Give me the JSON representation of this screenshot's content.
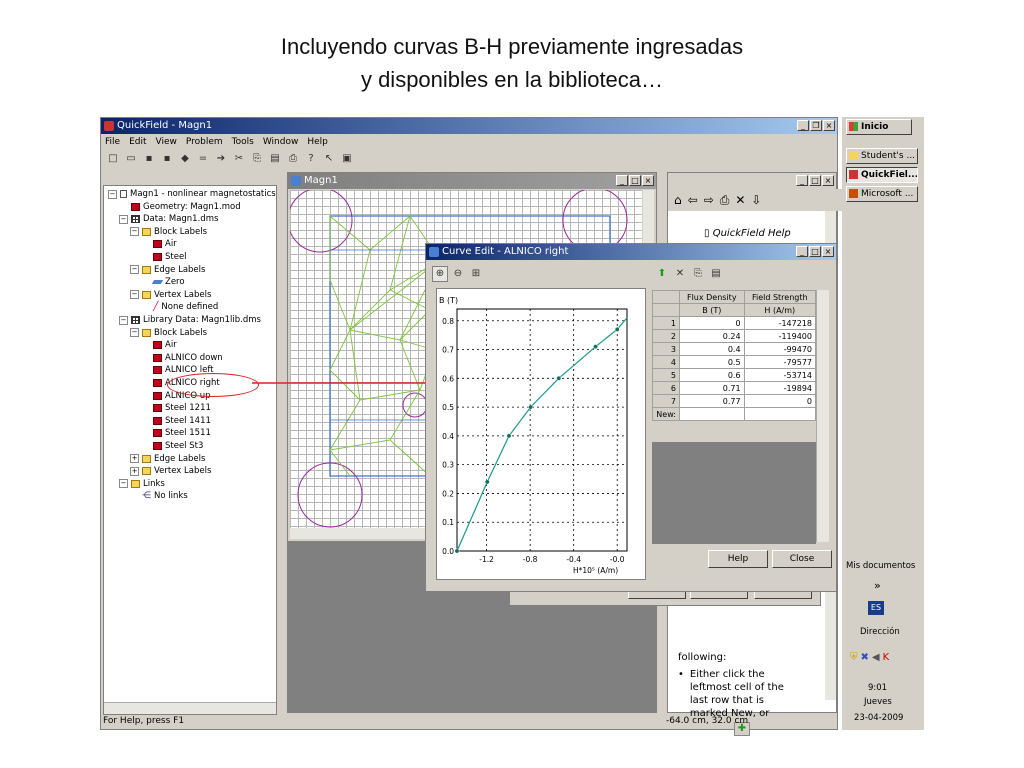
{
  "caption": {
    "line1": "Incluyendo curvas B-H previamente ingresadas",
    "line2": "y disponibles en la biblioteca…"
  },
  "main_window": {
    "title": "QuickField - Magn1",
    "menu": [
      "File",
      "Edit",
      "View",
      "Problem",
      "Tools",
      "Window",
      "Help"
    ],
    "status_left": "For Help, press F1",
    "status_right": "-64.0 cm, 32.0 cm"
  },
  "tree": {
    "items": [
      {
        "label": "Magn1 - nonlinear magnetostatics p",
        "icon": "doc-icon",
        "expander": "−"
      },
      {
        "label": "Geometry: Magn1.mod",
        "icon": "geometry-icon",
        "expander": ""
      },
      {
        "label": "Data: Magn1.dms",
        "icon": "table-icon",
        "expander": "−"
      },
      {
        "label": "Block Labels",
        "icon": "folder-icon",
        "expander": "−"
      },
      {
        "label": "Air",
        "icon": "block-icon",
        "expander": ""
      },
      {
        "label": "Steel",
        "icon": "block-icon",
        "expander": ""
      },
      {
        "label": "Edge Labels",
        "icon": "folder-icon",
        "expander": "−"
      },
      {
        "label": "Zero",
        "icon": "edge-icon",
        "expander": ""
      },
      {
        "label": "Vertex Labels",
        "icon": "folder-icon",
        "expander": "−"
      },
      {
        "label": "None defined",
        "icon": "vertex-icon",
        "expander": ""
      },
      {
        "label": "Library Data: Magn1lib.dms",
        "icon": "table-icon",
        "expander": "−"
      },
      {
        "label": "Block Labels",
        "icon": "folder-icon",
        "expander": "−"
      },
      {
        "label": "Air",
        "icon": "block-icon",
        "expander": ""
      },
      {
        "label": "ALNICO down",
        "icon": "block-icon",
        "expander": ""
      },
      {
        "label": "ALNICO left",
        "icon": "block-icon",
        "expander": ""
      },
      {
        "label": "ALNICO right",
        "icon": "block-icon",
        "expander": ""
      },
      {
        "label": "ALNICO up",
        "icon": "block-icon",
        "expander": ""
      },
      {
        "label": "Steel 1211",
        "icon": "block-icon",
        "expander": ""
      },
      {
        "label": "Steel 1411",
        "icon": "block-icon",
        "expander": ""
      },
      {
        "label": "Steel 1511",
        "icon": "block-icon",
        "expander": ""
      },
      {
        "label": "Steel St3",
        "icon": "block-icon",
        "expander": ""
      },
      {
        "label": "Edge Labels",
        "icon": "folder-icon",
        "expander": "+"
      },
      {
        "label": "Vertex Labels",
        "icon": "folder-icon",
        "expander": "+"
      },
      {
        "label": "Links",
        "icon": "folder-icon",
        "expander": "−"
      },
      {
        "label": "No links",
        "icon": "links-icon",
        "expander": ""
      }
    ]
  },
  "model_window": {
    "title": "Magn1"
  },
  "curve_dialog": {
    "title": "Curve Edit - ALNICO right",
    "plot_ylabel": "B (T)",
    "y_ticks": [
      "0.8",
      "0.7",
      "0.6",
      "0.5",
      "0.4",
      "0.3",
      "0.2",
      "0.1",
      "0.0"
    ],
    "x_ticks": [
      "-1.2",
      "-0.8",
      "-0.4",
      "-0.0"
    ],
    "x_axis_label": "H*10⁵ (A/m)",
    "table_headers": [
      [
        "Flux Density",
        "B (T)"
      ],
      [
        "Field Strength",
        "H (A/m)"
      ]
    ],
    "rows": [
      {
        "n": "1",
        "b": "0",
        "h": "-147218"
      },
      {
        "n": "2",
        "b": "0.24",
        "h": "-119400"
      },
      {
        "n": "3",
        "b": "0.4",
        "h": "-99470"
      },
      {
        "n": "4",
        "b": "0.5",
        "h": "-79577"
      },
      {
        "n": "5",
        "b": "0.6",
        "h": "-53714"
      },
      {
        "n": "6",
        "b": "0.71",
        "h": "-19894"
      },
      {
        "n": "7",
        "b": "0.77",
        "h": "0"
      }
    ],
    "new_row_label": "New:",
    "help_button": "Help",
    "close_button": "Close",
    "chart_data": {
      "type": "line",
      "x": [
        -147218,
        -119400,
        -99470,
        -79577,
        -53714,
        -19894,
        0
      ],
      "y": [
        0,
        0.24,
        0.4,
        0.5,
        0.6,
        0.71,
        0.77
      ],
      "xlabel": "H*10⁵ (A/m)",
      "ylabel": "B (T)",
      "xlim": [
        -147218,
        9000
      ],
      "ylim": [
        0,
        0.82
      ],
      "grid": true
    }
  },
  "help_window": {
    "title": "QuickField Help",
    "bullet_lines": [
      "following:",
      "Either click the",
      "leftmost cell of the",
      "last row that is",
      "marked New, or"
    ]
  },
  "taskbar": {
    "start": "Inicio",
    "items": [
      "Student's ...",
      "QuickFiel...",
      "Microsoft ..."
    ],
    "mis_documentos": "Mis documentos",
    "chevron": "»",
    "lang": "ES",
    "direccion": "Dirección",
    "time": "9:01",
    "day": "Jueves",
    "date": "23-04-2009"
  },
  "colors": {
    "accent": "#0a246a",
    "curve": "#199a8a",
    "mesh": "#7cc43a",
    "highlight": "#dd2222"
  }
}
